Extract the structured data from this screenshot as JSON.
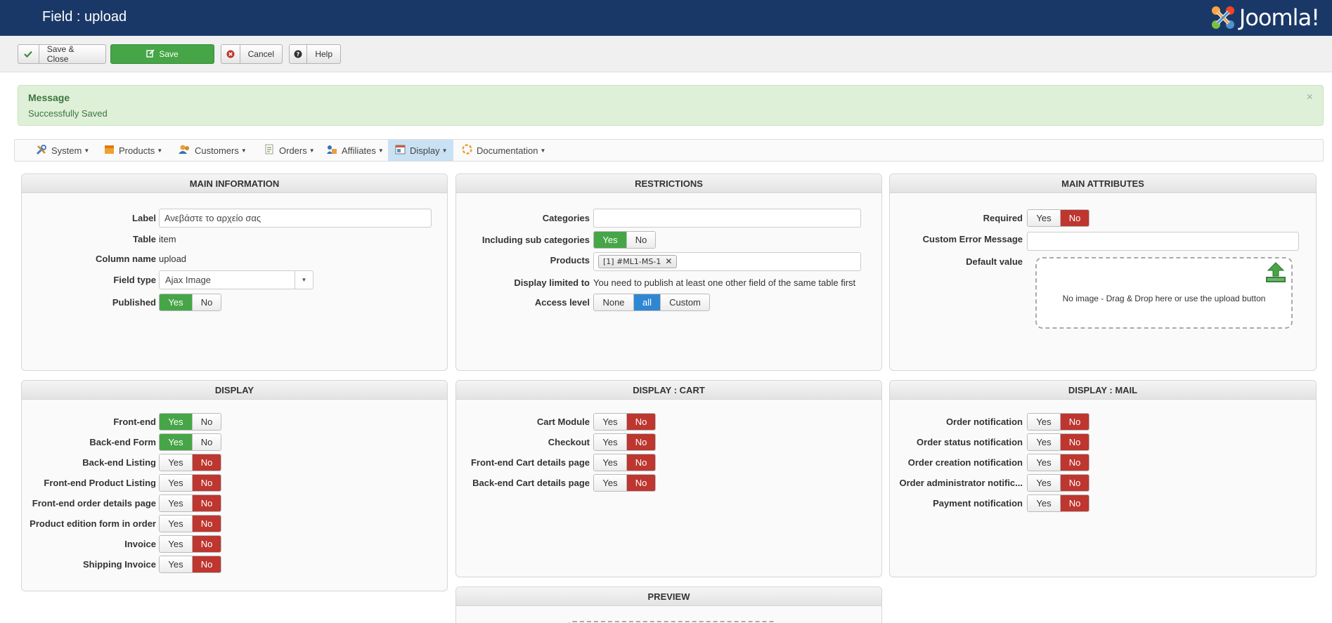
{
  "header": {
    "title": "Field : upload",
    "logo_text": "Joomla!"
  },
  "toolbar": {
    "save_close": "Save & Close",
    "save": "Save",
    "cancel": "Cancel",
    "help": "Help"
  },
  "message": {
    "heading": "Message",
    "text": "Successfully Saved",
    "close": "×"
  },
  "nav": [
    {
      "label": "System",
      "icon": "tools-icon"
    },
    {
      "label": "Products",
      "icon": "box-icon"
    },
    {
      "label": "Customers",
      "icon": "users-icon"
    },
    {
      "label": "Orders",
      "icon": "document-icon"
    },
    {
      "label": "Affiliates",
      "icon": "affiliates-icon"
    },
    {
      "label": "Display",
      "icon": "display-icon",
      "active": true
    },
    {
      "label": "Documentation",
      "icon": "help-icon"
    }
  ],
  "main_info": {
    "title": "MAIN INFORMATION",
    "label_label": "Label",
    "label_value": "Ανεβάστε το αρχείο σας",
    "table_label": "Table",
    "table_value": "item",
    "column_label": "Column name",
    "column_value": "upload",
    "fieldtype_label": "Field type",
    "fieldtype_value": "Ajax Image",
    "published_label": "Published"
  },
  "restrictions": {
    "title": "RESTRICTIONS",
    "categories_label": "Categories",
    "subcats_label": "Including sub categories",
    "products_label": "Products",
    "product_tag": "[1] #ML1-MS-1",
    "display_limited_label": "Display limited to",
    "display_limited_value": "You need to publish at least one other field of the same table first",
    "access_label": "Access level",
    "access_options": [
      "None",
      "all",
      "Custom"
    ],
    "access_selected": "all"
  },
  "main_attributes": {
    "title": "MAIN ATTRIBUTES",
    "required_label": "Required",
    "custom_error_label": "Custom Error Message",
    "default_value_label": "Default value",
    "dropzone_text": "No image - Drag & Drop here or use the upload button"
  },
  "toggle_labels": {
    "yes": "Yes",
    "no": "No"
  },
  "display": {
    "title": "DISPLAY",
    "rows": [
      {
        "label": "Front-end",
        "value": "Yes"
      },
      {
        "label": "Back-end Form",
        "value": "Yes"
      },
      {
        "label": "Back-end Listing",
        "value": "No"
      },
      {
        "label": "Front-end Product Listing",
        "value": "No"
      },
      {
        "label": "Front-end order details page",
        "value": "No"
      },
      {
        "label": "Product edition form in order",
        "value": "No"
      },
      {
        "label": "Invoice",
        "value": "No"
      },
      {
        "label": "Shipping Invoice",
        "value": "No"
      }
    ]
  },
  "display_cart": {
    "title": "DISPLAY : CART",
    "rows": [
      {
        "label": "Cart Module",
        "value": "No"
      },
      {
        "label": "Checkout",
        "value": "No"
      },
      {
        "label": "Front-end Cart details page",
        "value": "No"
      },
      {
        "label": "Back-end Cart details page",
        "value": "No"
      }
    ]
  },
  "display_mail": {
    "title": "DISPLAY : MAIL",
    "rows": [
      {
        "label": "Order notification",
        "value": "No"
      },
      {
        "label": "Order status notification",
        "value": "No"
      },
      {
        "label": "Order creation notification",
        "value": "No"
      },
      {
        "label": "Order administrator notific...",
        "value": "No"
      },
      {
        "label": "Payment notification",
        "value": "No"
      }
    ]
  },
  "preview": {
    "title": "PREVIEW"
  },
  "colors": {
    "header_bg": "#1a3867",
    "yes_on": "#46a546",
    "no_on": "#bd362f",
    "selected": "#2f87d2"
  }
}
